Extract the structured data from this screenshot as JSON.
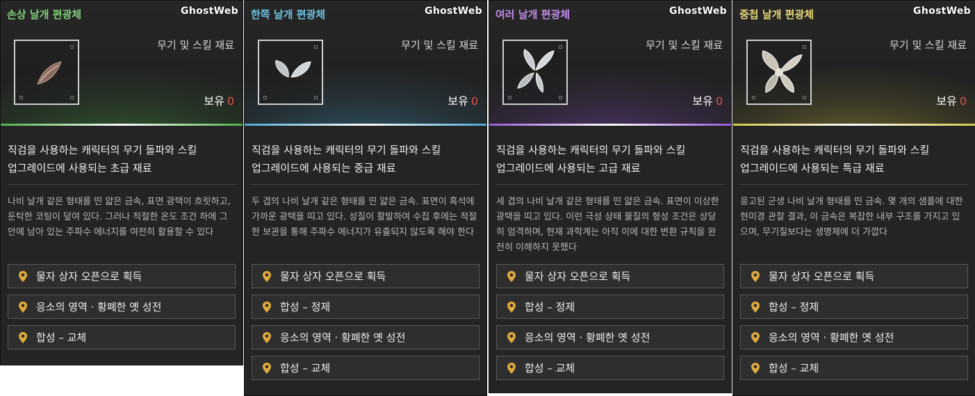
{
  "cards": [
    {
      "title": "손상 날개 편광체",
      "title_color": "#7fd17a",
      "accent": "#4fb04a",
      "watermark": "GhostWeb",
      "category": "무기 및 스킬 재료",
      "owned_label": "보유",
      "owned_count": "0",
      "icon": "damaged-wing-icon",
      "summary_line1": "직검을 사용하는 캐릭터의 무기 돌파와 스킬",
      "summary_line2": "업그레이드에 사용되는 초급 재료",
      "desc": "나비 날개 같은 형태를 띤 얇은 금속, 표면 광택이 흐릿하고, 둔탁한 코팅이 덮여 있다. 그러나 적절한 온도 조건 하에 그 안에 남아 있는 주파수 에너지를 여전히 활용할 수 있다",
      "sources": [
        "물자 상자 오픈으로 획득",
        "응소의 영역 · 황폐한 옛 성전",
        "합성 – 교체"
      ]
    },
    {
      "title": "한쪽 날개 편광체",
      "title_color": "#6ec3e3",
      "accent": "#4aa7d2",
      "watermark": "GhostWeb",
      "category": "무기 및 스킬 재료",
      "owned_label": "보유",
      "owned_count": "0",
      "icon": "single-wing-icon",
      "summary_line1": "직검을 사용하는 캐릭터의 무기 돌파와 스킬",
      "summary_line2": "업그레이드에 사용되는 중급 재료",
      "desc": "두 겹의 나비 날개 같은 형태를 띤 얇은 금속. 표면이 흑석에 가까운 광택을 띠고 있다. 성질이 활발하여 수집 후에는 적절한 보관을 통해 주파수 에너지가 유출되지 않도록 해야 한다",
      "sources": [
        "물자 상자 오픈으로 획득",
        "합성 – 정제",
        "응소의 영역 · 황폐한 옛 성전",
        "합성 – 교체"
      ]
    },
    {
      "title": "여러 날개 편광체",
      "title_color": "#c08be8",
      "accent": "#9a55d8",
      "watermark": "GhostWeb",
      "category": "무기 및 스킬 재료",
      "owned_label": "보유",
      "owned_count": "0",
      "icon": "multi-wing-icon",
      "summary_line1": "직검을 사용하는 캐릭터의 무기 돌파와 스킬",
      "summary_line2": "업그레이드에 사용되는 고급 재료",
      "desc": "세 겹의 나비 날개 같은 형태를 띤 얇은 금속. 표면이 이상한 광택을 띠고 있다. 이런 극성 상태 물질의 형성 조건은 상당히 엄격하며, 현재 과학계는 아직 이에 대한 변환 규칙을 완전히 이해하지 못했다",
      "sources": [
        "물자 상자 오픈으로 획득",
        "합성 – 정제",
        "응소의 영역 · 황폐한 옛 성전",
        "합성 – 교체"
      ]
    },
    {
      "title": "중첩 날개 편광체",
      "title_color": "#e8d87a",
      "accent": "#d8c84a",
      "watermark": "GhostWeb",
      "category": "무기 및 스킬 재료",
      "owned_label": "보유",
      "owned_count": "0",
      "icon": "layered-wing-icon",
      "summary_line1": "직검을 사용하는 캐릭터의 무기 돌파와 스킬",
      "summary_line2": "업그레이드에 사용되는 특급 재료",
      "desc": "응고된 군생 나비 날개 형태를 띤 금속. 몇 개의 샘플에 대한 현미경 관찰 결과, 이 금속은 복잡한 내부 구조를 가지고 있으며, 무기질보다는 생명체에 더 가깝다",
      "sources": [
        "물자 상자 오픈으로 획득",
        "합성 – 정제",
        "응소의 영역 · 황폐한 옛 성전",
        "합성 – 교체"
      ]
    }
  ]
}
